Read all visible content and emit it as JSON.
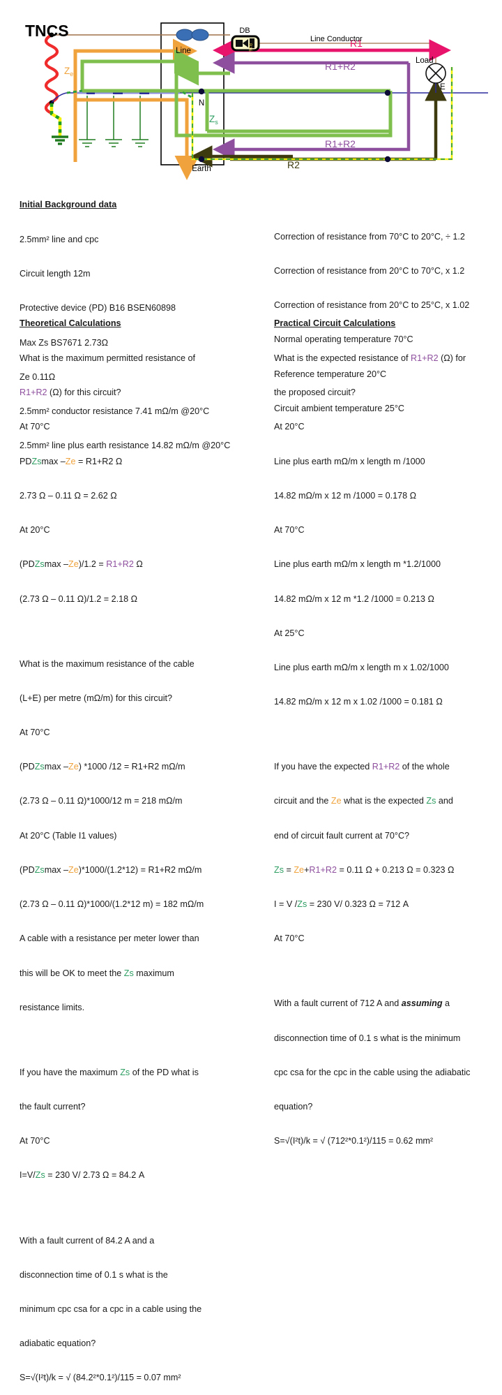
{
  "colors": {
    "r1": "#e8146b",
    "r1r2": "#8e4f9e",
    "r2": "#3d3a10",
    "zs": "#7fbf4d",
    "zs_text": "#2e9e63",
    "ze": "#f0a33c",
    "line_conductor": "#a0714a",
    "neutral": "#3333aa",
    "earth_green": "#1f7a1f",
    "cpc_yellow": "#f2f20d",
    "transformer_red": "#ef2b2b"
  },
  "diagram": {
    "title": "TNCS",
    "labels": {
      "ze": "Z",
      "ze_sub": "e",
      "zs": "Z",
      "zs_sub": "s",
      "db": "DB",
      "db_rating": "B16",
      "line": "Line",
      "neutral": "N",
      "earth": "Earth",
      "line_conductor": "Line Conductor",
      "load": "Load",
      "load_e": "E",
      "r1": "R1",
      "r1r2_top": "R1+R2",
      "r1r2_bottom": "R1+R2",
      "r2": "R2"
    }
  },
  "background": {
    "heading": "Initial Background data",
    "lines_left": [
      "2.5mm² line and cpc",
      "Circuit length 12m",
      "Protective device (PD) B16 BSEN60898",
      "Max Zs BS7671 2.73Ω",
      "Ze 0.11Ω",
      "2.5mm² conductor resistance 7.41 mΩ/m @20°C",
      "2.5mm² line plus earth resistance 14.82 mΩ/m @20°C"
    ],
    "lines_right": [
      "Correction of resistance from 70°C to 20°C, ÷ 1.2",
      "Correction of resistance from 20°C to 70°C, x 1.2",
      "Correction of resistance from 20°C to 25°C, x 1.02",
      "Normal operating temperature 70°C",
      "Reference temperature 20°C",
      "Circuit ambient temperature 25°C"
    ]
  },
  "theoretical": {
    "heading": "Theoretical Calculations",
    "q1_a": "What is the maximum permitted resistance of",
    "q1_r1r2": "R1+R2",
    "q1_b": " (Ω) for this circuit?",
    "t70": "At 70°C",
    "pd": "PD",
    "zs": "Zs",
    "max_dash": "max –",
    "ze": "Ze",
    "eq1_end": " = R1+R2 Ω",
    "eq1_val": "2.73 Ω – 0.11 Ω = 2.62 Ω",
    "t20": "At 20°C",
    "eq2_open": "(PD",
    "eq2_end": ")/1.2 = ",
    "eq2_r1r2": "R1+R2",
    "eq2_ohm": " Ω",
    "eq2_val": "(2.73 Ω – 0.11 Ω)/1.2 = 2.18 Ω",
    "q2_a": "What is the maximum resistance of the cable",
    "q2_b": "(L+E) per metre (mΩ/m) for this circuit?",
    "eq3_end": ") *1000 /12 = R1+R2 mΩ/m",
    "eq3_val": "(2.73 Ω – 0.11 Ω)*1000/12 m = 218 mΩ/m",
    "t20_table": "At 20°C (Table I1 values)",
    "eq4_end": ")*1000/(1.2*12) = R1+R2 mΩ/m",
    "eq4_val": "(2.73 Ω – 0.11 Ω)*1000/(1.2*12 m) = 182 mΩ/m",
    "note_a": "A cable with a resistance per meter lower than",
    "note_b": "this will be OK to meet the ",
    "note_zs": "Zs",
    "note_c": " maximum",
    "note_d": "resistance limits.",
    "q3_a": "If you have the maximum ",
    "q3_zs": "Zs",
    "q3_b": " of the PD what is",
    "q3_c": "the fault current?",
    "i_eq_a": "I=V/",
    "i_eq_zs": "Zs",
    "i_eq_b": " = 230 V/ 2.73 Ω = 84.2 A",
    "q4_a": "With a fault current of 84.2 A and a",
    "q4_b": "disconnection time of 0.1 s what is the",
    "q4_c": "minimum cpc csa for a cpc in a cable using the",
    "q4_d": "adiabatic equation?",
    "q4_eq": "S=√(I²t)/k = √ (84.2²*0.1²)/115 = 0.07 mm²"
  },
  "practical": {
    "heading": "Practical Circuit Calculations",
    "q1_a": "What is the expected resistance of ",
    "q1_r1r2": "R1+R2",
    "q1_b": " (Ω) for",
    "q1_c": "the proposed circuit?",
    "t20": "At 20°C",
    "l20_a": "Line plus earth mΩ/m x length m /1000",
    "l20_b": "14.82 mΩ/m x 12 m /1000 = 0.178 Ω",
    "t70": "At 70°C",
    "l70_a": "Line plus earth mΩ/m x length m *1.2/1000",
    "l70_b": "14.82 mΩ/m x 12 m *1.2 /1000 = 0.213 Ω",
    "t25": "At 25°C",
    "l25_a": "Line plus earth mΩ/m x length m x 1.02/1000",
    "l25_b": "14.82 mΩ/m x 12 m x 1.02 /1000 = 0.181 Ω",
    "q2_a": "If you have the expected ",
    "q2_r1r2": "R1+R2",
    "q2_b": " of the whole",
    "q2_c": "circuit and the ",
    "q2_ze": "Ze",
    "q2_d": " what is the expected ",
    "q2_zs": "Zs",
    "q2_e": " and",
    "q2_f": "end of circuit fault current at 70°C?",
    "zs_eq_a": "Zs",
    "zs_eq_b": " = ",
    "zs_eq_ze": "Ze",
    "zs_eq_plus": "+",
    "zs_eq_r1r2": "R1+R2",
    "zs_eq_c": " = 0.11 Ω + 0.213 Ω = 0.323 Ω",
    "i_eq_a": "I = V /",
    "i_eq_zs": "Zs",
    "i_eq_b": " = 230 V/ 0.323 Ω = 712 A",
    "t70b": "At 70°C",
    "q3_a": "With a fault current of 712 A and ",
    "q3_assuming": "assuming",
    "q3_b": " a",
    "q3_c": "disconnection time of 0.1 s what is the minimum",
    "q3_d": "cpc csa for the cpc in the cable using the adiabatic",
    "q3_e": "equation?",
    "q3_eq": "S=√(I²t)/k = √ (712²*0.1²)/115 = 0.62 mm²"
  }
}
